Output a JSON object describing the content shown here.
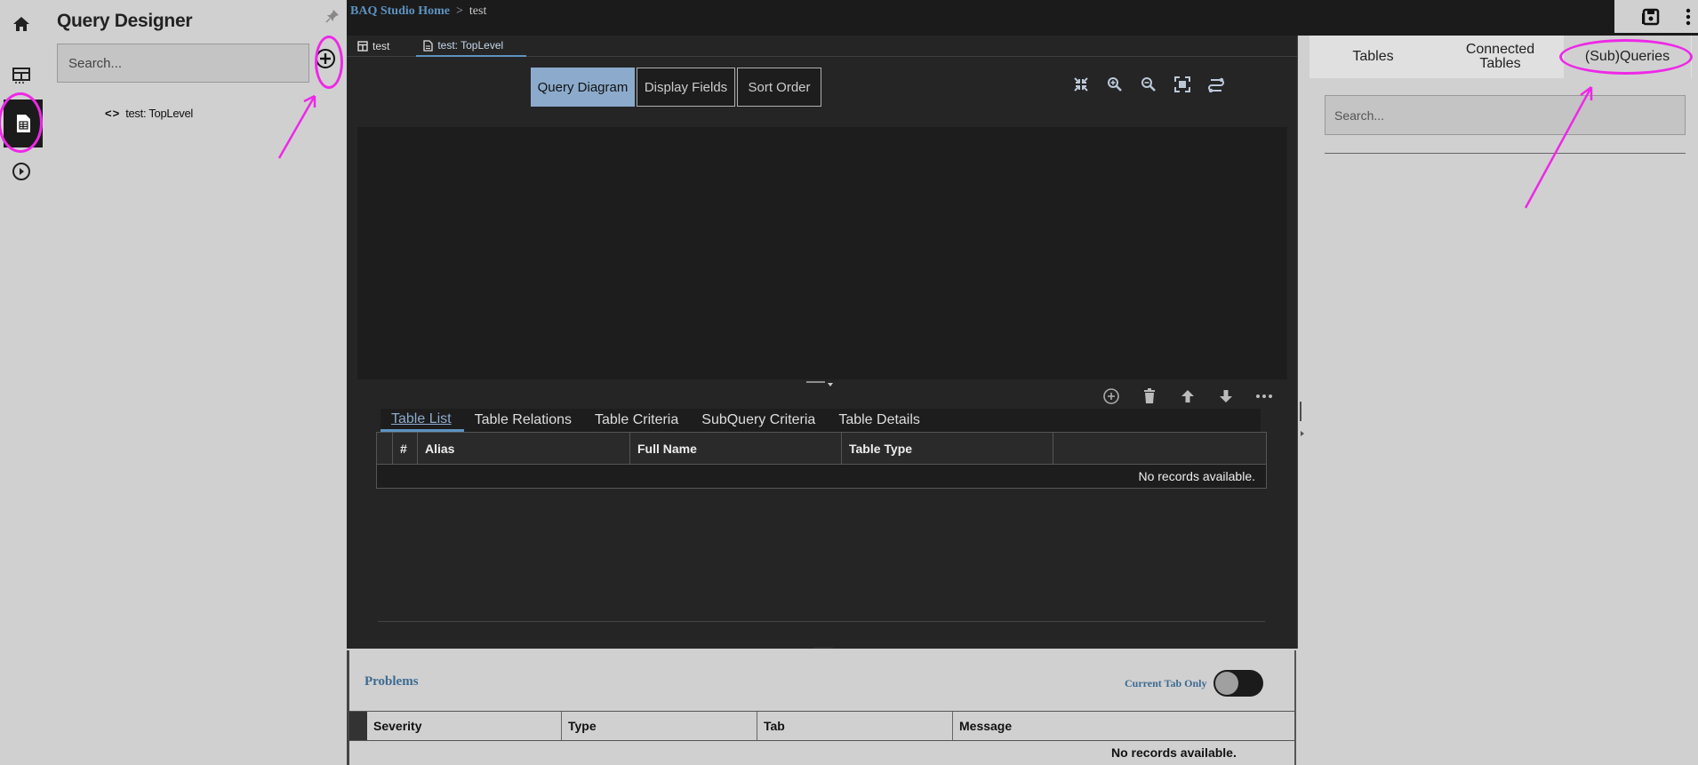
{
  "app": {
    "title": "Query Designer",
    "search_placeholder": "Search...",
    "tree_item": "test: TopLevel"
  },
  "nav": {
    "rail": [
      {
        "icon": "home-icon"
      },
      {
        "icon": "grid-icon"
      },
      {
        "icon": "document-icon",
        "active": true
      },
      {
        "icon": "play-circle-icon"
      }
    ]
  },
  "breadcrumb": {
    "home": "BAQ Studio Home",
    "separator": ">",
    "current": "test"
  },
  "doc_tabs": [
    {
      "label": "test",
      "icon": "table-icon"
    },
    {
      "label": "test: TopLevel",
      "icon": "document-icon",
      "active": true
    }
  ],
  "view_tabs": [
    {
      "label": "Query Diagram",
      "active": true
    },
    {
      "label": "Display Fields"
    },
    {
      "label": "Sort Order"
    }
  ],
  "sub_tabs": [
    {
      "label": "Table List",
      "active": true
    },
    {
      "label": "Table Relations"
    },
    {
      "label": "Table Criteria"
    },
    {
      "label": "SubQuery Criteria"
    },
    {
      "label": "Table Details"
    }
  ],
  "table_list": {
    "columns": [
      "#",
      "Alias",
      "Full Name",
      "Table Type",
      ""
    ],
    "empty_text": "No records available."
  },
  "problems": {
    "title": "Problems",
    "toggle_label": "Current Tab Only",
    "toggle_on": false,
    "columns": [
      "Severity",
      "Type",
      "Tab",
      "Message"
    ],
    "empty_text": "No records available."
  },
  "right_panel": {
    "tabs": [
      {
        "label": "Tables"
      },
      {
        "label": "Connected Tables"
      },
      {
        "label": "(Sub)Queries",
        "active": true
      }
    ],
    "search_placeholder": "Search..."
  },
  "colors": {
    "annotation": "#ee28e8",
    "accent": "#5d93c1",
    "dark_bg": "#1b1b1b"
  }
}
